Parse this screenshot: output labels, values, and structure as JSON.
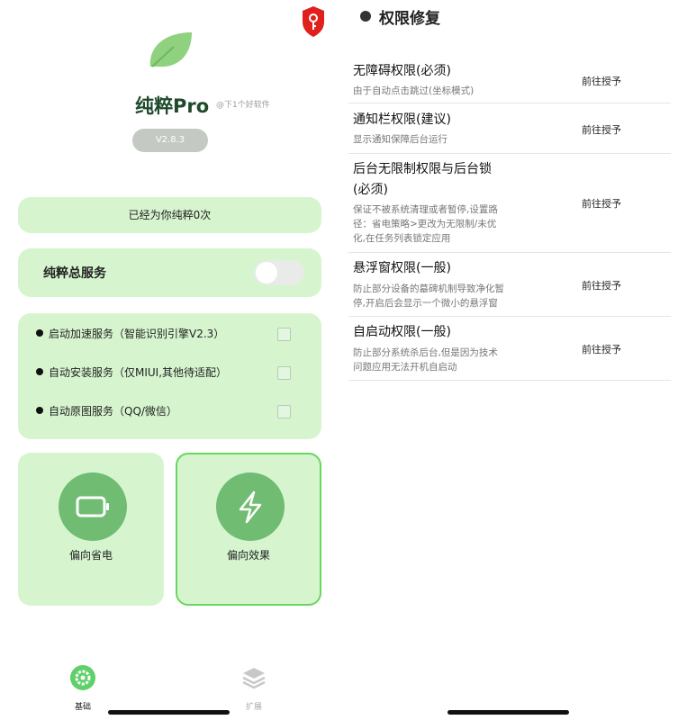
{
  "left": {
    "app_name": "纯粹Pro",
    "credit": "@下1个好软件",
    "version": "V2.8.3",
    "count_text": "已经为你纯粹0次",
    "main_service": {
      "label": "纯粹总服务",
      "enabled": false
    },
    "services": [
      {
        "label": "启动加速服务（智能识别引擎V2.3）",
        "checked": false
      },
      {
        "label": "自动安装服务（仅MIUI,其他待适配）",
        "checked": false
      },
      {
        "label": "自动原图服务（QQ/微信）",
        "checked": false
      }
    ],
    "modes": [
      {
        "label": "偏向省电",
        "icon": "battery-icon",
        "selected": false
      },
      {
        "label": "偏向效果",
        "icon": "lightning-icon",
        "selected": true
      }
    ],
    "nav": [
      {
        "label": "基础",
        "icon": "gear-icon",
        "active": true
      },
      {
        "label": "扩展",
        "icon": "layers-icon",
        "active": false
      }
    ],
    "colors": {
      "accent": "#70bc72",
      "card": "#d6f5cf",
      "selected_border": "#69d65f",
      "title": "#1f4a2c"
    }
  },
  "right": {
    "section_title": "权限修复",
    "permissions": [
      {
        "title": "无障碍权限(必须)",
        "desc": [
          "由于自动点击跳过(坐标模式)"
        ],
        "button": "前往授予"
      },
      {
        "title": "通知栏权限(建议)",
        "desc": [
          "显示通知保障后台运行"
        ],
        "button": "前往授予"
      },
      {
        "title": [
          "后台无限制权限与后台锁",
          "(必须)"
        ],
        "desc": [
          "保证不被系统清理或者暂停,设置路",
          "径：省电策略>更改为无限制/未优",
          "化,在任务列表锁定应用"
        ],
        "button": "前往授予"
      },
      {
        "title": "悬浮窗权限(一般)",
        "desc": [
          "防止部分设备的墓碑机制导致净化暂",
          "停,开启后会显示一个微小的悬浮窗"
        ],
        "button": "前往授予"
      },
      {
        "title": "自启动权限(一般)",
        "desc": [
          "防止部分系统杀后台,但是因为技术",
          "问题应用无法开机自启动"
        ],
        "button": "前往授予"
      }
    ]
  }
}
